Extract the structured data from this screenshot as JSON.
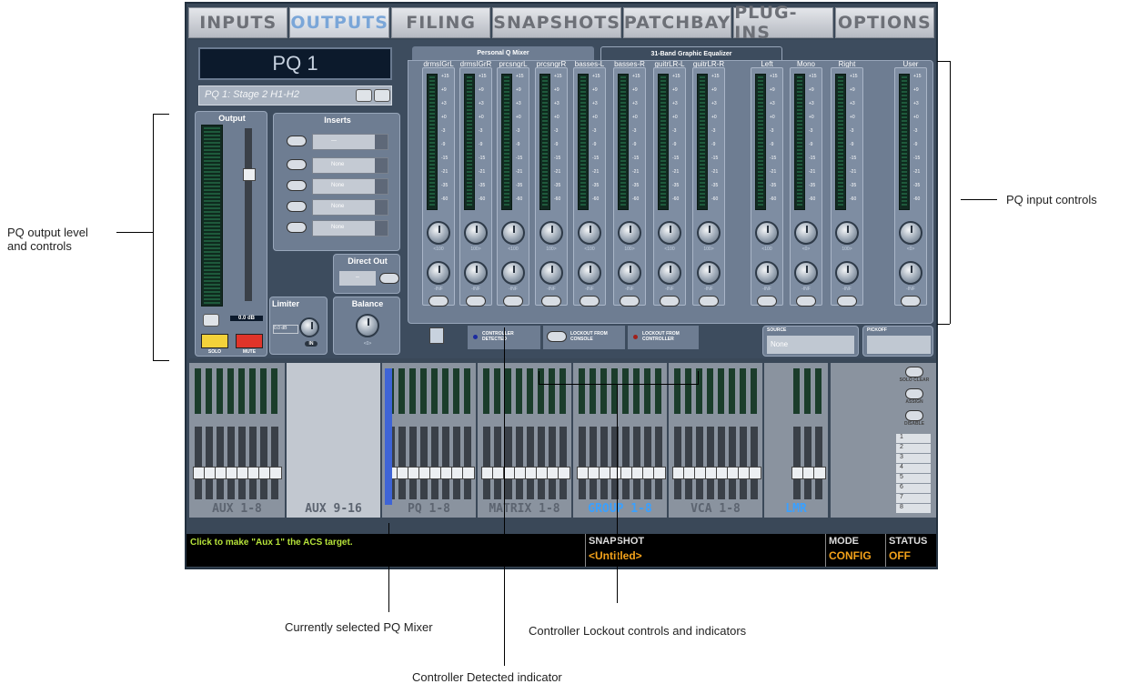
{
  "tabs": [
    "INPUTS",
    "OUTPUTS",
    "FILING",
    "SNAPSHOTS",
    "PATCHBAY",
    "PLUG-INS",
    "OPTIONS"
  ],
  "pq": {
    "name": "PQ 1",
    "channel": "PQ 1: Stage 2 H1-H2"
  },
  "output": {
    "title": "Output",
    "value": "0.0 dB",
    "solo": "SOLO",
    "mute": "MUTE"
  },
  "inserts": {
    "title": "Inserts",
    "rows": [
      "—",
      "None",
      "None",
      "None",
      "None"
    ]
  },
  "direct_out": {
    "title": "Direct Out",
    "value": "–"
  },
  "limiter": {
    "title": "Limiter",
    "value": "0.0 dB",
    "in": "IN"
  },
  "balance": {
    "title": "Balance",
    "value": "<0>"
  },
  "mixer_tabs": [
    "Personal Q Mixer",
    "31-Band Graphic Equalizer"
  ],
  "channels": [
    "drmsIGrL",
    "drmsIGrR",
    "prcsngrL",
    "prcsngrR",
    "basses-L",
    "basses-R",
    "guitrLR-L",
    "guitrLR-R",
    "Left",
    "Mono",
    "Right",
    "User"
  ],
  "pan_values": [
    "<100",
    "100>",
    "<100",
    "100>",
    "<100",
    "100>",
    "<100",
    "100>",
    "<100",
    "<0>",
    "100>",
    "<0>"
  ],
  "gain_value": "-INF",
  "scale": [
    "+15",
    "+9",
    "+3",
    "+0",
    "-3",
    "-9",
    "-15",
    "-21",
    "-35",
    "-60"
  ],
  "lockout": {
    "detected": "CONTROLLER DETECTED",
    "from_console": "LOCKOUT FROM CONSOLE",
    "from_controller": "LOCKOUT FROM CONTROLLER"
  },
  "source": {
    "label": "SOURCE",
    "value": "None"
  },
  "pickoff": {
    "label": "PICKOFF"
  },
  "banks": [
    "AUX 1-8",
    "AUX 9-16",
    "PQ 1-8",
    "MATRIX 1-8",
    "GROUP 1-8",
    "VCA 1-8",
    "LMR"
  ],
  "side_buttons": [
    "SOLO CLEAR",
    "ASSIGN",
    "DISABLE"
  ],
  "side_numbers": [
    "1",
    "2",
    "3",
    "4",
    "5",
    "6",
    "7",
    "8"
  ],
  "status": {
    "message": "Click to make \"Aux 1\" the ACS target.",
    "snapshot_label": "SNAPSHOT",
    "snapshot_value": "<Untitled>",
    "mode_label": "MODE",
    "mode_value": "CONFIG",
    "status_label": "STATUS",
    "status_value": "OFF"
  },
  "annotations": {
    "output": "PQ output level and controls",
    "input": "PQ input controls",
    "selected": "Currently selected PQ Mixer",
    "lockout": "Controller Lockout controls and indicators",
    "detected": "Controller Detected indicator"
  }
}
